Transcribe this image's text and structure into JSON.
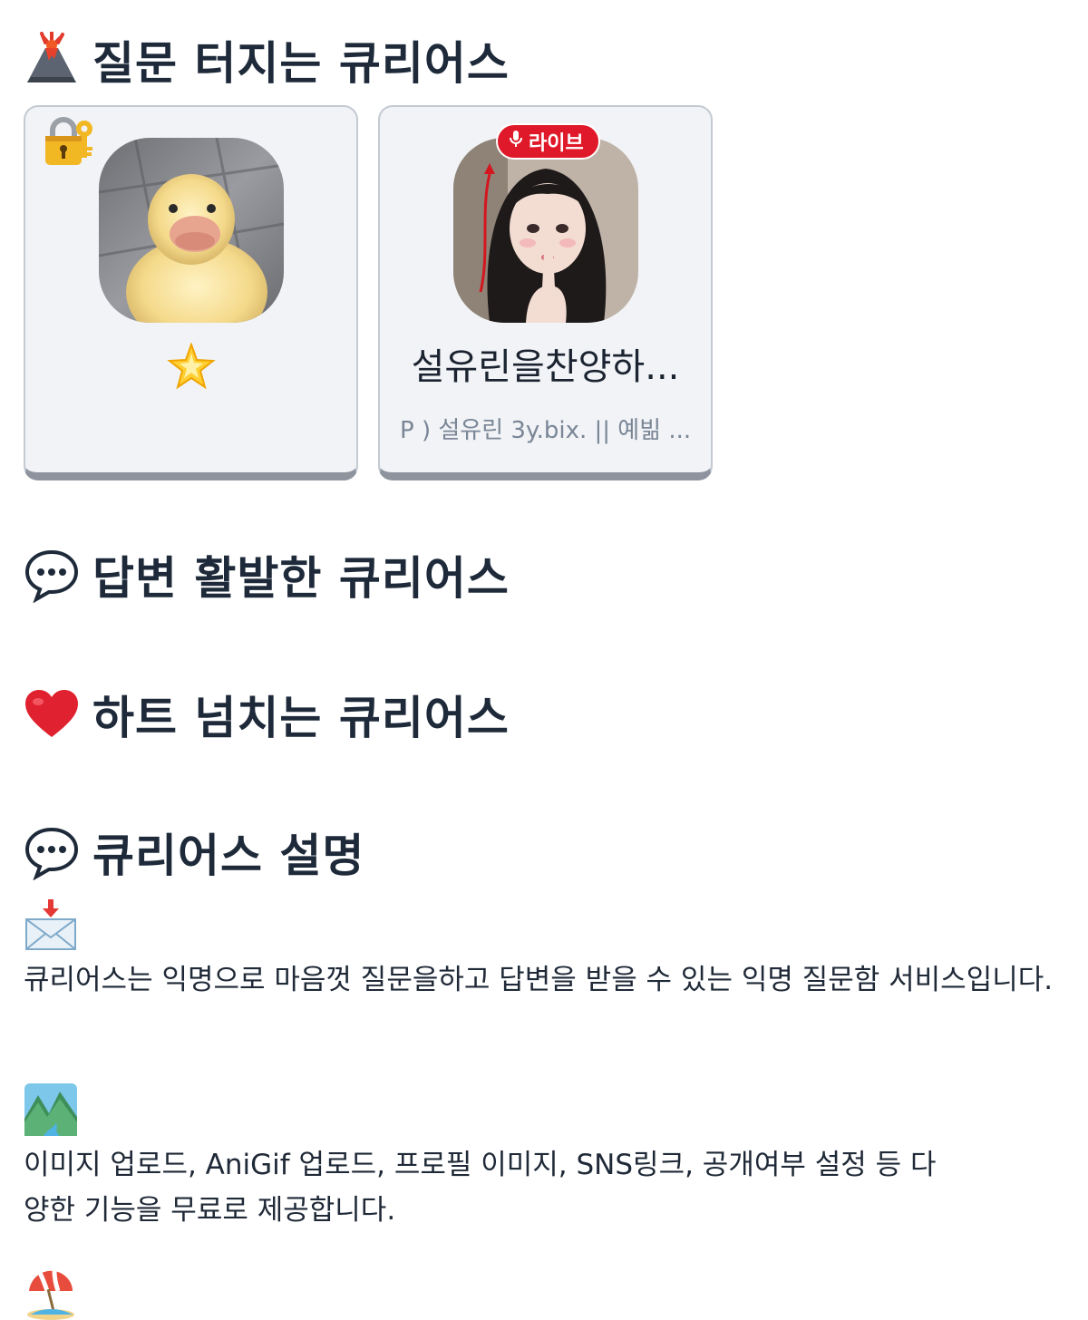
{
  "sections": {
    "hot_questions": {
      "title": "질문 터지는 큐리어스",
      "icon": "volcano-icon"
    },
    "active_answers": {
      "title": "답변 활발한 큐리어스",
      "icon": "speech-bubble-icon"
    },
    "hearts": {
      "title": "하트 넘치는 큐리어스",
      "icon": "red-heart-icon"
    },
    "about": {
      "title": "큐리어스 설명",
      "icon": "speech-bubble-icon"
    }
  },
  "cards": [
    {
      "badge_icon": "lock-with-key-icon",
      "avatar": "duckling-photo",
      "mark_icon": "glowing-star-icon"
    },
    {
      "badge_label": "라이브",
      "avatar": "girl-photo",
      "name": "설유린을찬양하...",
      "description": "P ) 설유린 3y.bix. || 예빎 ..."
    }
  ],
  "about_items": [
    {
      "icon": "envelope-with-arrow-icon",
      "text": "큐리어스는 익명으로 마음껏 질문을하고 답변을 받을 수 있는 익명 질문함 서비스입니다."
    },
    {
      "icon": "national-park-icon",
      "text": "이미지 업로드, AniGif 업로드, 프로필 이미지, SNS링크, 공개여부 설정 등 다양한 기능을 무료로 제공합니다."
    },
    {
      "icon": "beach-umbrella-icon"
    }
  ],
  "colors": {
    "title": "#1e2a3a",
    "card_bg": "#f1f3f6",
    "card_shadow": "#8d949e",
    "live": "#e0192a",
    "muted": "#7a8696"
  }
}
